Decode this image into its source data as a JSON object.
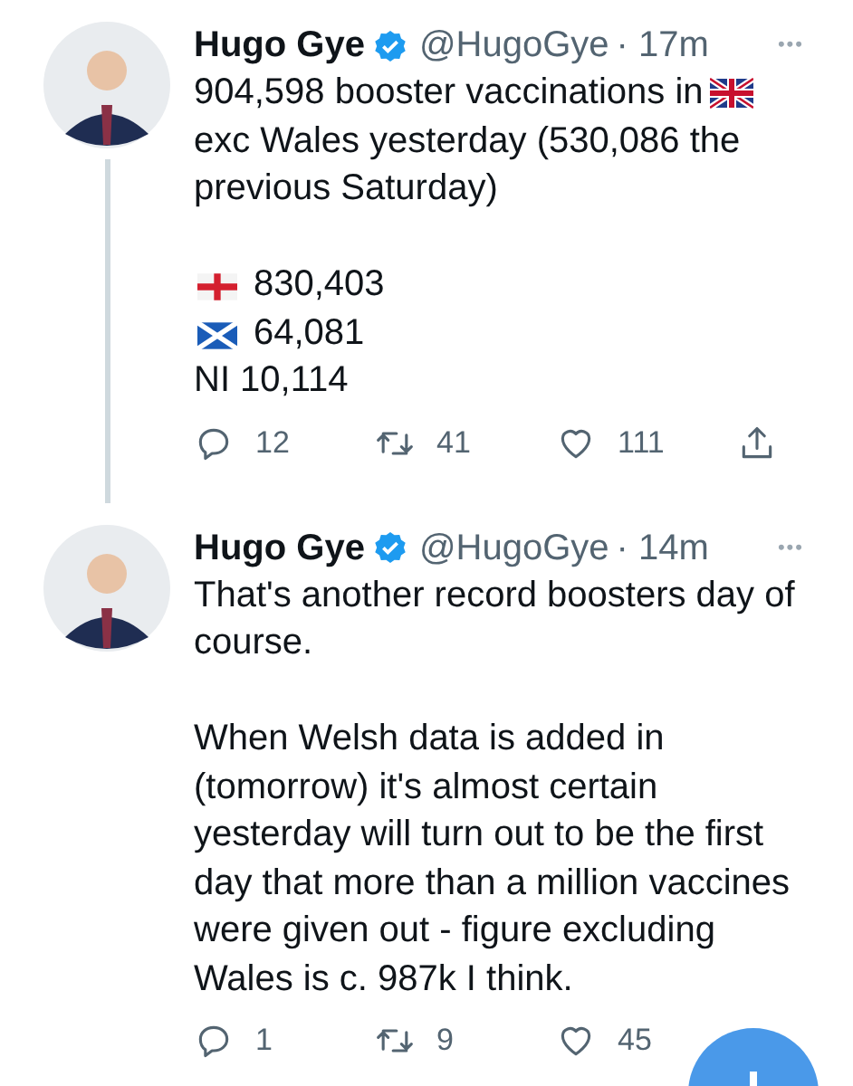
{
  "tweets": [
    {
      "name": "Hugo Gye",
      "verified": true,
      "handle": "@HugoGye",
      "time": "· 17m",
      "thread_line": true,
      "more": "•••",
      "paragraphs": [
        {
          "lines": [
            [
              {
                "kind": "text",
                "text": "904,598 booster vaccinations in"
              },
              {
                "kind": "uk-flag"
              },
              {
                "kind": "text",
                "text": "exc Wales yesterday (530,086 the previous Saturday)"
              }
            ]
          ]
        },
        {
          "lines": [
            [
              {
                "kind": "england-flag"
              },
              {
                "kind": "text",
                "text": "830,403"
              }
            ],
            [
              {
                "kind": "scotland-flag"
              },
              {
                "kind": "text",
                "text": "64,081"
              }
            ],
            [
              {
                "kind": "text",
                "text": "NI 10,114"
              }
            ]
          ]
        }
      ],
      "actions": [
        {
          "kind": "reply",
          "count": "12"
        },
        {
          "kind": "retweet",
          "count": "41"
        },
        {
          "kind": "like",
          "count": "111"
        },
        {
          "kind": "share"
        }
      ]
    },
    {
      "name": "Hugo Gye",
      "verified": true,
      "handle": "@HugoGye",
      "time": "· 14m",
      "thread_line": false,
      "more": "•••",
      "paragraphs": [
        {
          "lines": [
            [
              {
                "kind": "text",
                "text": "That's another record boosters day of course."
              }
            ]
          ]
        },
        {
          "lines": [
            [
              {
                "kind": "text",
                "text": "When Welsh data is added in (tomorrow) it's almost certain yesterday will turn out to be the first day that more than a million vaccines were given out - figure excluding Wales is c. 987k I think."
              }
            ]
          ]
        }
      ],
      "actions": [
        {
          "kind": "reply",
          "count": "1"
        },
        {
          "kind": "retweet",
          "count": "9"
        },
        {
          "kind": "like",
          "count": "45"
        }
      ]
    }
  ],
  "compose_button": {
    "visible": true
  }
}
